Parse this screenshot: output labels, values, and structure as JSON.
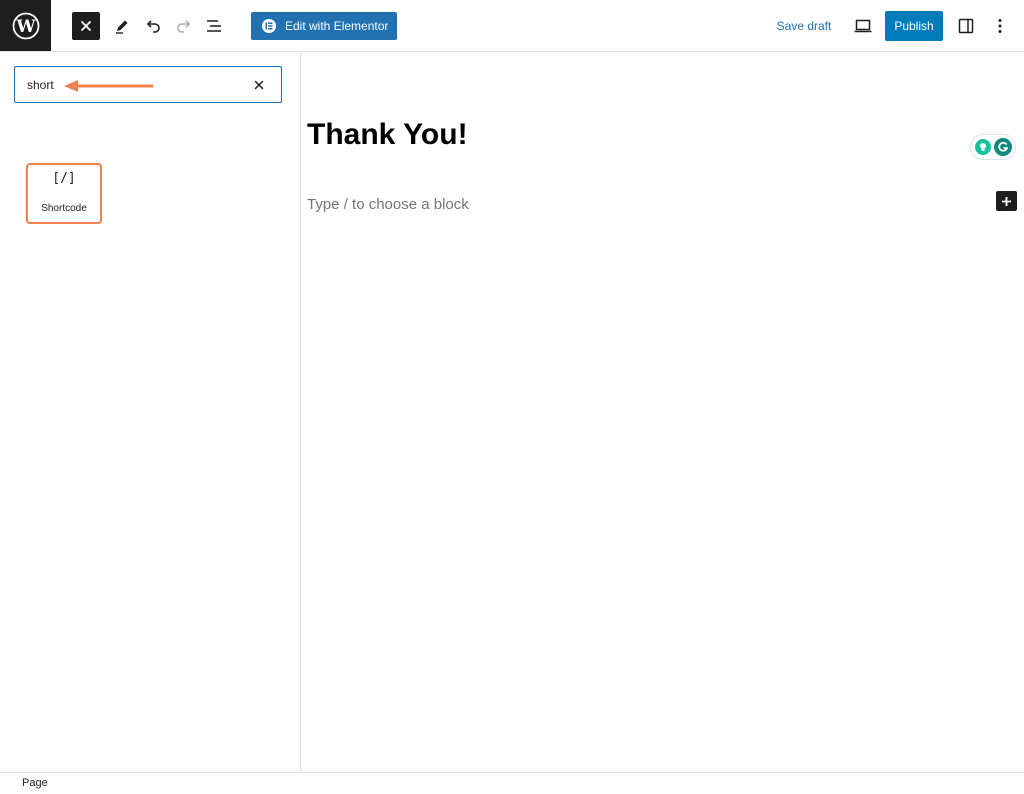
{
  "toolbar": {
    "edit_elementor_label": "Edit with Elementor",
    "save_draft_label": "Save draft",
    "publish_label": "Publish"
  },
  "inserter": {
    "search_value": "short",
    "results": [
      {
        "icon_text": "[/]",
        "label": "Shortcode"
      }
    ]
  },
  "editor": {
    "title": "Thank You!",
    "block_placeholder": "Type / to choose a block"
  },
  "footer": {
    "breadcrumb": "Page"
  },
  "colors": {
    "accent": "#2271b1",
    "publish": "#007cba",
    "highlight": "#f0814d"
  }
}
